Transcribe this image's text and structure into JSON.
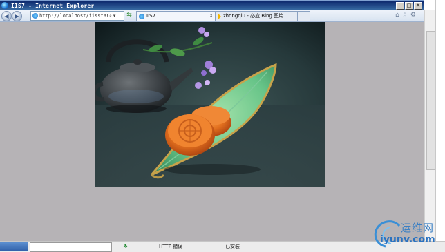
{
  "window": {
    "title": "IIS7 - Internet Explorer",
    "controls": [
      "_",
      "□",
      "X"
    ]
  },
  "browser": {
    "address": "http://localhost/iisstart.ht",
    "address_icons": [
      "search-icon",
      "dropdown-icon"
    ],
    "tabs": [
      {
        "label": "IIS7",
        "icon": "ie-icon"
      },
      {
        "label": "zhongqiu - 必应 Bing 图片",
        "icon": "bing-icon"
      }
    ],
    "tab_close": "X",
    "toolbar_icons": [
      "home-icon",
      "favorites-icon",
      "tools-icon"
    ]
  },
  "content": {
    "background": "#b6b3b6",
    "image": {
      "subject": "mooncakes-on-leaf-plate"
    }
  },
  "taskbar": {
    "item_name": "HTTP 错误",
    "item_status": "已安装"
  },
  "watermark": {
    "cn": "运维网",
    "url": "iyunv.com"
  }
}
